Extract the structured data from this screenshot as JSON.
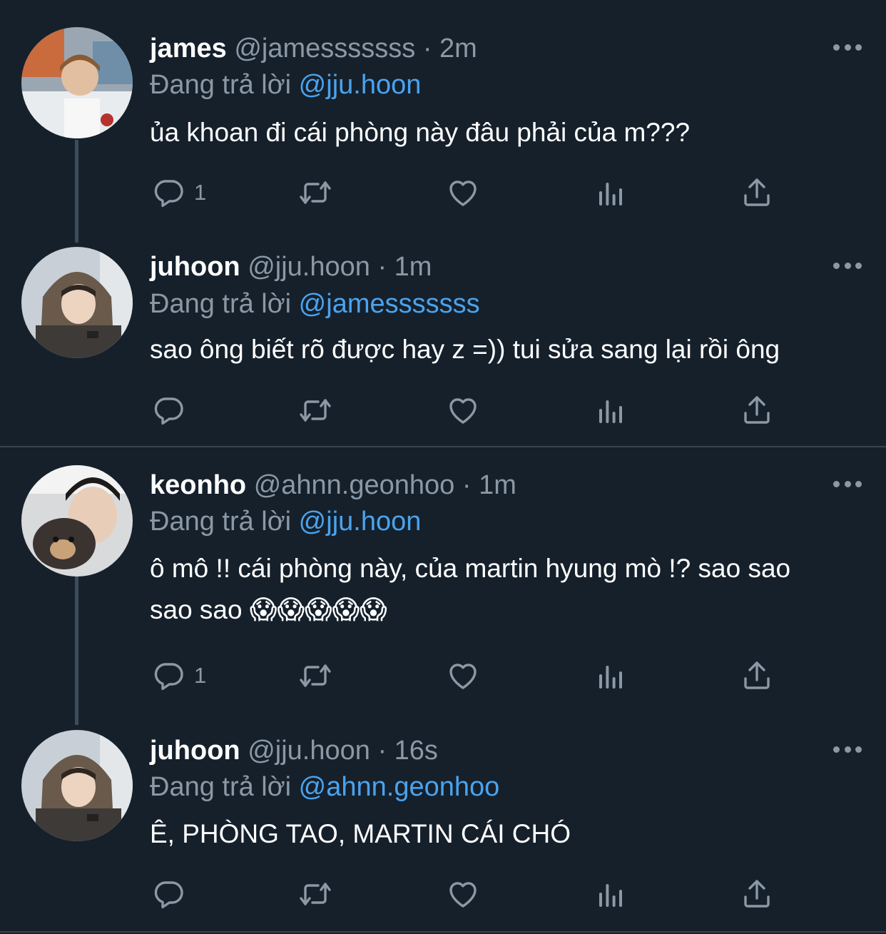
{
  "tweets": [
    {
      "name": "james",
      "handle": "@jamesssssss",
      "dot": "·",
      "time": "2m",
      "reply_prefix": "Đang trả lời",
      "reply_to": "@jju.hoon",
      "text": "ủa khoan đi cái phòng này đâu phải của m???",
      "reply_count": "1"
    },
    {
      "name": "juhoon",
      "handle": "@jju.hoon",
      "dot": "·",
      "time": "1m",
      "reply_prefix": "Đang trả lời",
      "reply_to": "@jamesssssss",
      "text": "sao ông biết rõ được hay z =)) tui sửa sang lại rồi ông",
      "reply_count": ""
    },
    {
      "name": "keonho",
      "handle": "@ahnn.geonhoo",
      "dot": "·",
      "time": "1m",
      "reply_prefix": "Đang trả lời",
      "reply_to": "@jju.hoon",
      "text": "ô mô !! cái phòng này, của martin hyung mò !? sao sao sao sao 😱😱😱😱😱",
      "reply_count": "1"
    },
    {
      "name": "juhoon",
      "handle": "@jju.hoon",
      "dot": "·",
      "time": "16s",
      "reply_prefix": "Đang trả lời",
      "reply_to": "@ahnn.geonhoo",
      "text": "Ê, PHÒNG TAO, MARTIN CÁI CHÓ",
      "reply_count": ""
    }
  ],
  "icons": {
    "reply": "reply-icon",
    "retweet": "retweet-icon",
    "like": "heart-icon",
    "views": "views-icon",
    "share": "share-icon",
    "more": "more-icon"
  },
  "colors": {
    "background": "#15202b",
    "mention": "#4aa3ee",
    "muted": "#8b98a5",
    "thread_line": "#3d4c5c"
  }
}
